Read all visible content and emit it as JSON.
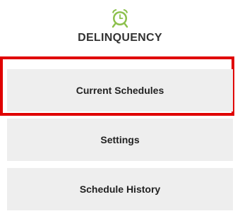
{
  "header": {
    "logo_icon": "alarm-clock-icon",
    "title": "DELINQUENCY"
  },
  "menu": {
    "items": [
      {
        "label": "Current Schedules",
        "selected": true
      },
      {
        "label": "Settings",
        "selected": false
      },
      {
        "label": "Schedule History",
        "selected": false
      }
    ]
  },
  "colors": {
    "accent_green": "#8cc04b",
    "highlight_red": "#e00000",
    "button_bg": "#eeeeee",
    "text": "#222222"
  }
}
